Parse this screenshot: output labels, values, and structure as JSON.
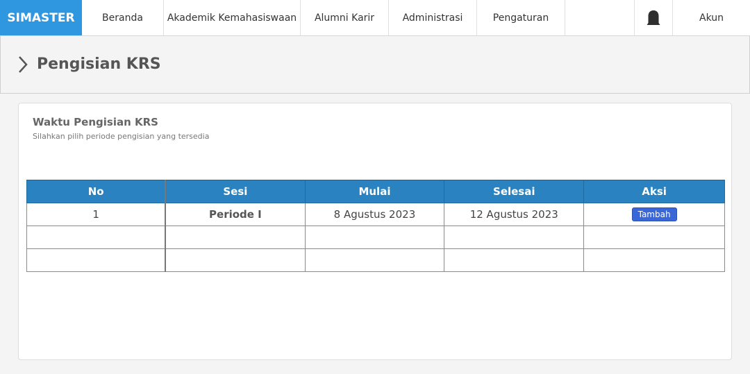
{
  "nav": {
    "brand": "SIMASTER",
    "items": [
      {
        "label": "Beranda"
      },
      {
        "label": "Akademik Kemahasiswaan"
      },
      {
        "label": "Alumni Karir"
      },
      {
        "label": "Administrasi"
      },
      {
        "label": "Pengaturan"
      }
    ],
    "bell_icon": "bell-icon",
    "account_label": "Akun"
  },
  "page": {
    "title": "Pengisian KRS",
    "title_icon": "chevron-right-icon"
  },
  "card": {
    "title": "Waktu Pengisian KRS",
    "subtitle": "Silahkan pilih periode pengisian yang tersedia"
  },
  "table": {
    "headers": [
      "No",
      "Sesi",
      "Mulai",
      "Selesai",
      "Aksi"
    ],
    "rows": [
      {
        "no": "1",
        "sesi": "Periode I",
        "mulai": "8 Agustus 2023",
        "selesai": "12 Agustus 2023",
        "aksi": "Tambah"
      },
      {
        "no": "",
        "sesi": "",
        "mulai": "",
        "selesai": "",
        "aksi": ""
      },
      {
        "no": "",
        "sesi": "",
        "mulai": "",
        "selesai": "",
        "aksi": ""
      }
    ]
  },
  "colors": {
    "brand": "#2f96e0",
    "table_header": "#2b82c0",
    "button": "#3a67d8"
  }
}
